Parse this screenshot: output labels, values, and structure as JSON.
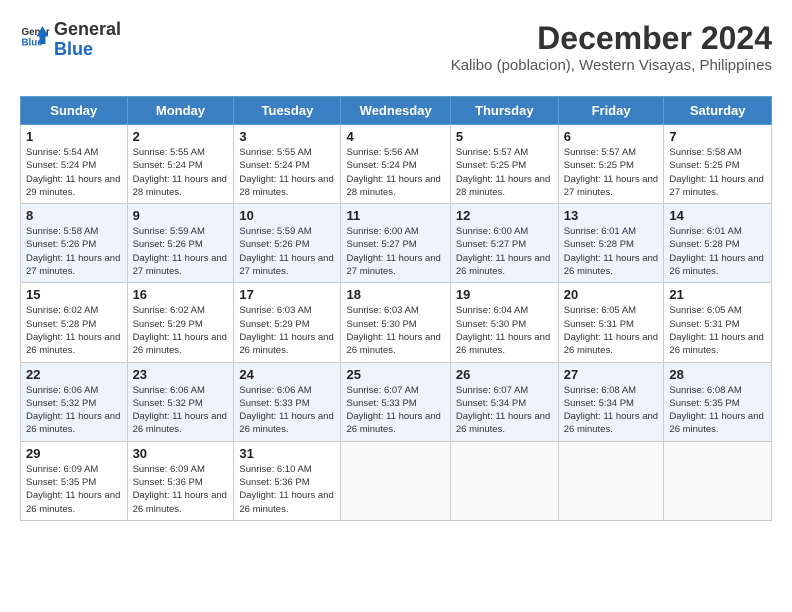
{
  "header": {
    "logo_general": "General",
    "logo_blue": "Blue",
    "title": "December 2024",
    "subtitle": "Kalibo (poblacion), Western Visayas, Philippines"
  },
  "days_of_week": [
    "Sunday",
    "Monday",
    "Tuesday",
    "Wednesday",
    "Thursday",
    "Friday",
    "Saturday"
  ],
  "weeks": [
    {
      "days": [
        {
          "num": "1",
          "sunrise": "5:54 AM",
          "sunset": "5:24 PM",
          "daylight": "11 hours and 29 minutes."
        },
        {
          "num": "2",
          "sunrise": "5:55 AM",
          "sunset": "5:24 PM",
          "daylight": "11 hours and 28 minutes."
        },
        {
          "num": "3",
          "sunrise": "5:55 AM",
          "sunset": "5:24 PM",
          "daylight": "11 hours and 28 minutes."
        },
        {
          "num": "4",
          "sunrise": "5:56 AM",
          "sunset": "5:24 PM",
          "daylight": "11 hours and 28 minutes."
        },
        {
          "num": "5",
          "sunrise": "5:57 AM",
          "sunset": "5:25 PM",
          "daylight": "11 hours and 28 minutes."
        },
        {
          "num": "6",
          "sunrise": "5:57 AM",
          "sunset": "5:25 PM",
          "daylight": "11 hours and 27 minutes."
        },
        {
          "num": "7",
          "sunrise": "5:58 AM",
          "sunset": "5:25 PM",
          "daylight": "11 hours and 27 minutes."
        }
      ]
    },
    {
      "days": [
        {
          "num": "8",
          "sunrise": "5:58 AM",
          "sunset": "5:26 PM",
          "daylight": "11 hours and 27 minutes."
        },
        {
          "num": "9",
          "sunrise": "5:59 AM",
          "sunset": "5:26 PM",
          "daylight": "11 hours and 27 minutes."
        },
        {
          "num": "10",
          "sunrise": "5:59 AM",
          "sunset": "5:26 PM",
          "daylight": "11 hours and 27 minutes."
        },
        {
          "num": "11",
          "sunrise": "6:00 AM",
          "sunset": "5:27 PM",
          "daylight": "11 hours and 27 minutes."
        },
        {
          "num": "12",
          "sunrise": "6:00 AM",
          "sunset": "5:27 PM",
          "daylight": "11 hours and 26 minutes."
        },
        {
          "num": "13",
          "sunrise": "6:01 AM",
          "sunset": "5:28 PM",
          "daylight": "11 hours and 26 minutes."
        },
        {
          "num": "14",
          "sunrise": "6:01 AM",
          "sunset": "5:28 PM",
          "daylight": "11 hours and 26 minutes."
        }
      ]
    },
    {
      "days": [
        {
          "num": "15",
          "sunrise": "6:02 AM",
          "sunset": "5:28 PM",
          "daylight": "11 hours and 26 minutes."
        },
        {
          "num": "16",
          "sunrise": "6:02 AM",
          "sunset": "5:29 PM",
          "daylight": "11 hours and 26 minutes."
        },
        {
          "num": "17",
          "sunrise": "6:03 AM",
          "sunset": "5:29 PM",
          "daylight": "11 hours and 26 minutes."
        },
        {
          "num": "18",
          "sunrise": "6:03 AM",
          "sunset": "5:30 PM",
          "daylight": "11 hours and 26 minutes."
        },
        {
          "num": "19",
          "sunrise": "6:04 AM",
          "sunset": "5:30 PM",
          "daylight": "11 hours and 26 minutes."
        },
        {
          "num": "20",
          "sunrise": "6:05 AM",
          "sunset": "5:31 PM",
          "daylight": "11 hours and 26 minutes."
        },
        {
          "num": "21",
          "sunrise": "6:05 AM",
          "sunset": "5:31 PM",
          "daylight": "11 hours and 26 minutes."
        }
      ]
    },
    {
      "days": [
        {
          "num": "22",
          "sunrise": "6:06 AM",
          "sunset": "5:32 PM",
          "daylight": "11 hours and 26 minutes."
        },
        {
          "num": "23",
          "sunrise": "6:06 AM",
          "sunset": "5:32 PM",
          "daylight": "11 hours and 26 minutes."
        },
        {
          "num": "24",
          "sunrise": "6:06 AM",
          "sunset": "5:33 PM",
          "daylight": "11 hours and 26 minutes."
        },
        {
          "num": "25",
          "sunrise": "6:07 AM",
          "sunset": "5:33 PM",
          "daylight": "11 hours and 26 minutes."
        },
        {
          "num": "26",
          "sunrise": "6:07 AM",
          "sunset": "5:34 PM",
          "daylight": "11 hours and 26 minutes."
        },
        {
          "num": "27",
          "sunrise": "6:08 AM",
          "sunset": "5:34 PM",
          "daylight": "11 hours and 26 minutes."
        },
        {
          "num": "28",
          "sunrise": "6:08 AM",
          "sunset": "5:35 PM",
          "daylight": "11 hours and 26 minutes."
        }
      ]
    },
    {
      "days": [
        {
          "num": "29",
          "sunrise": "6:09 AM",
          "sunset": "5:35 PM",
          "daylight": "11 hours and 26 minutes."
        },
        {
          "num": "30",
          "sunrise": "6:09 AM",
          "sunset": "5:36 PM",
          "daylight": "11 hours and 26 minutes."
        },
        {
          "num": "31",
          "sunrise": "6:10 AM",
          "sunset": "5:36 PM",
          "daylight": "11 hours and 26 minutes."
        },
        null,
        null,
        null,
        null
      ]
    }
  ]
}
